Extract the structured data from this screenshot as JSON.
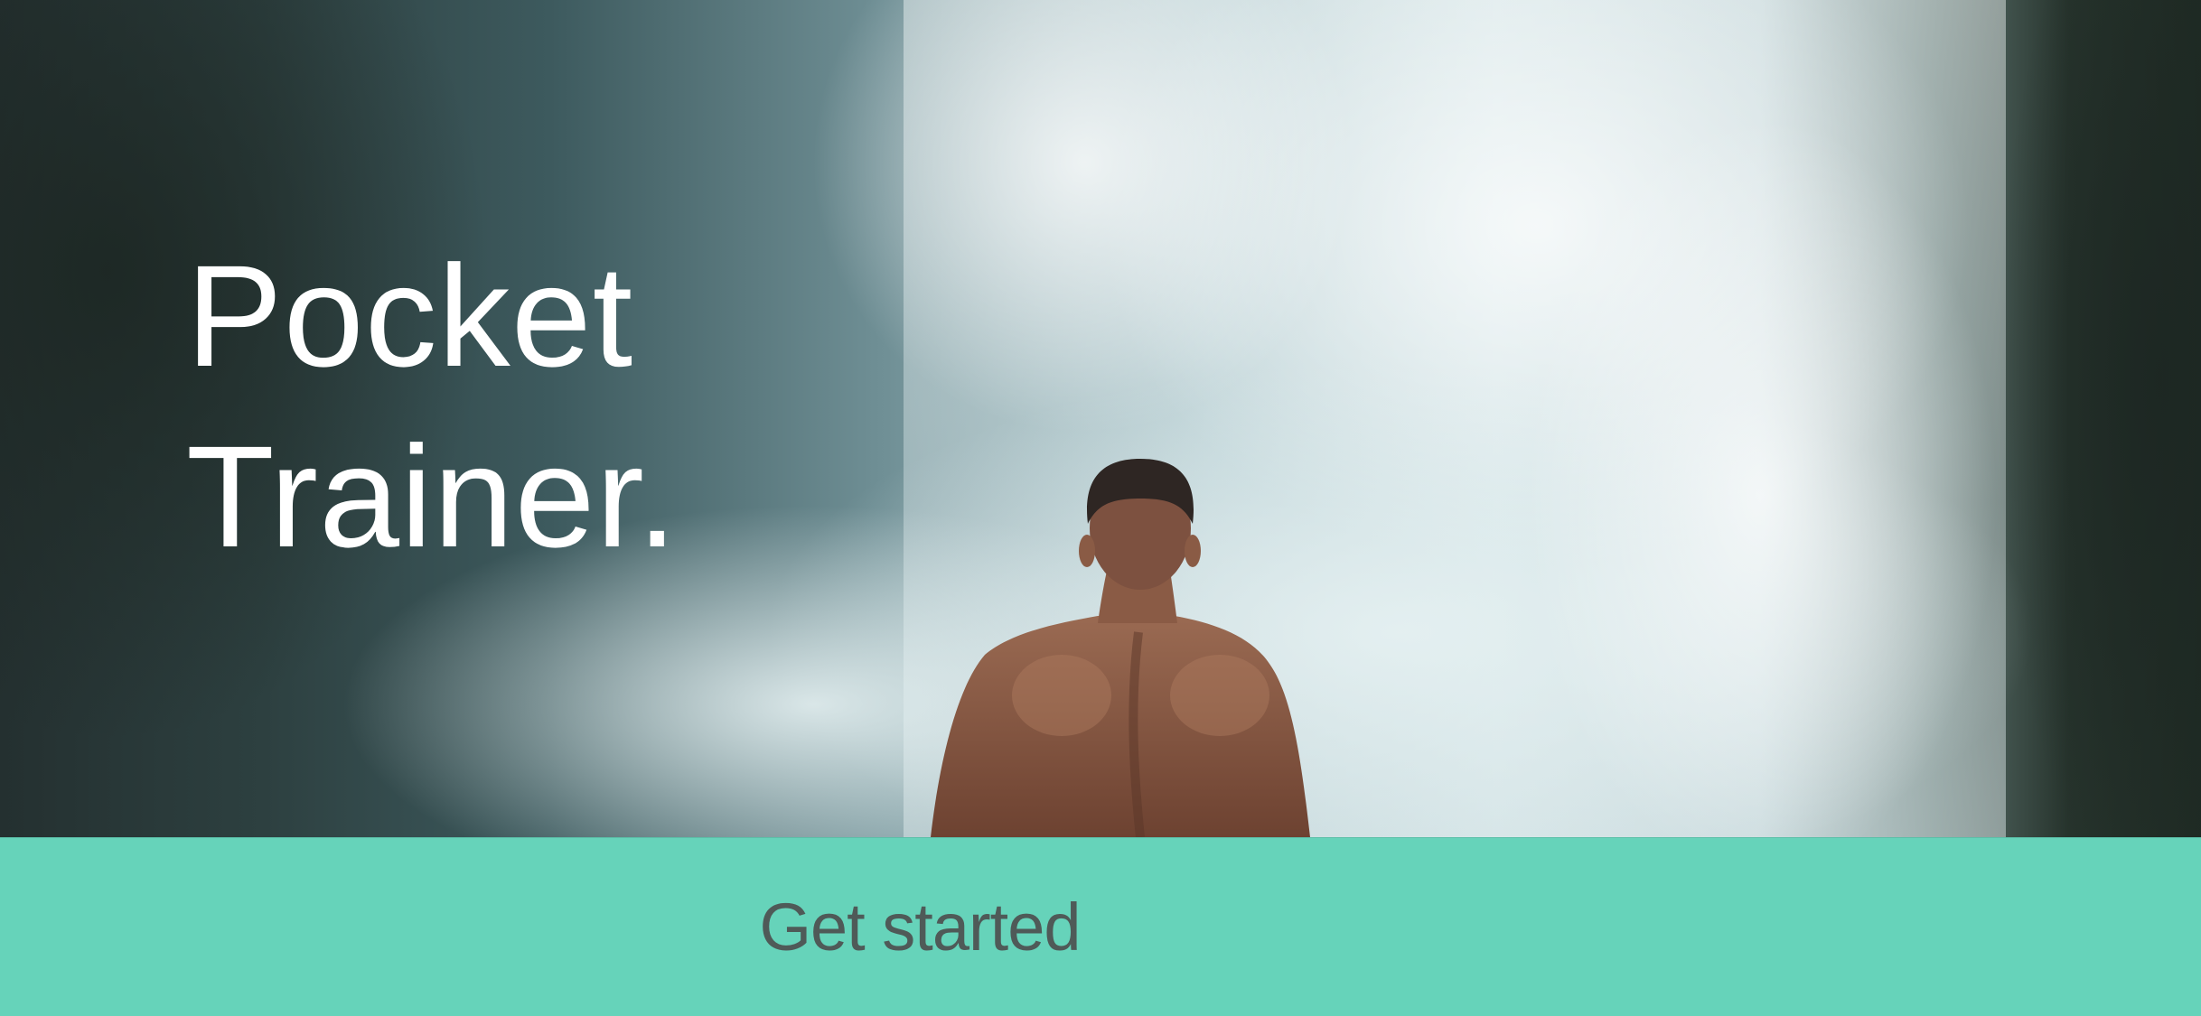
{
  "app": {
    "title_line1": "Pocket",
    "title_line2": "Trainer."
  },
  "cta": {
    "label": "Get started"
  },
  "colors": {
    "accent": "#66d3ba",
    "cta_text": "#4f5a58",
    "title_text": "#ffffff"
  },
  "hero": {
    "image": "man-in-front-of-waterfall-photo"
  }
}
